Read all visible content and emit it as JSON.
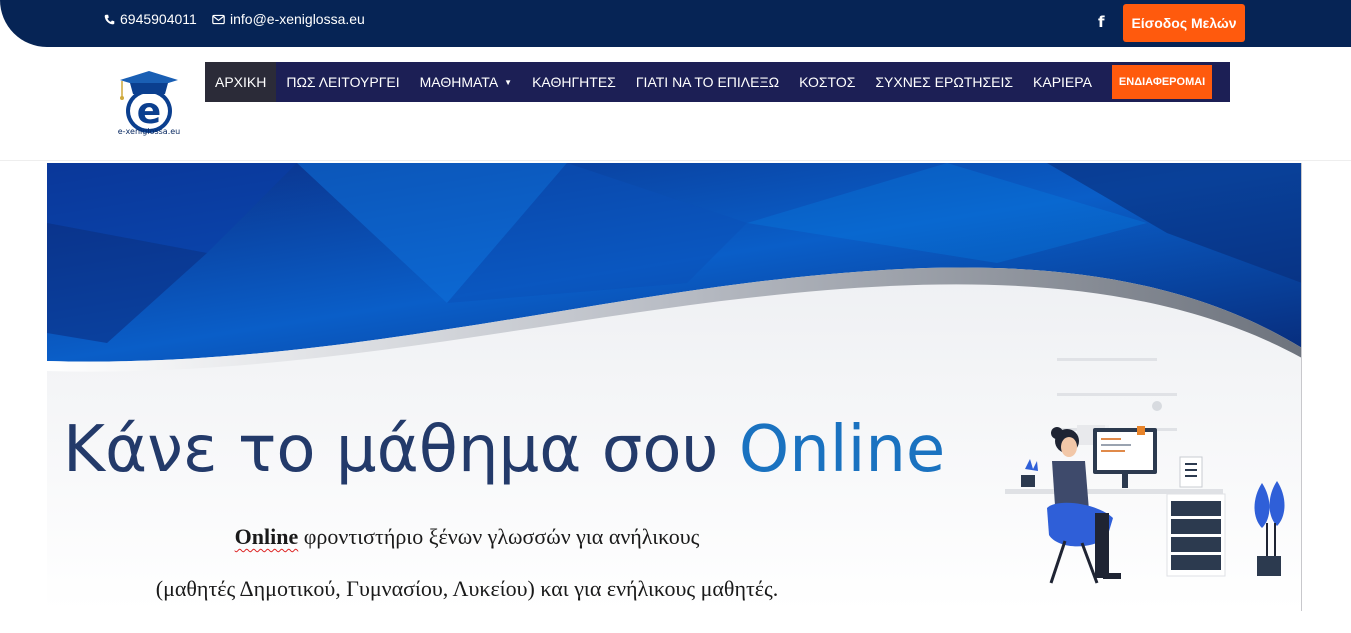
{
  "topbar": {
    "phone": "6945904011",
    "email": "info@e-xeniglossa.eu",
    "facebook_glyph": "f",
    "login_label": "Είσοδος Μελών"
  },
  "logo": {
    "letter": "e",
    "caption": "e-xeniglossa.eu"
  },
  "nav": {
    "items": [
      {
        "label": "ΑΡΧΙΚΗ"
      },
      {
        "label": "ΠΩΣ ΛΕΙΤΟΥΡΓΕΙ"
      },
      {
        "label": "ΜΑΘΗΜΑΤΑ"
      },
      {
        "label": "ΚΑΘΗΓΗΤΕΣ"
      },
      {
        "label": "ΓΙΑΤΙ ΝΑ ΤΟ ΕΠΙΛΕΞΩ"
      },
      {
        "label": "ΚΟΣΤΟΣ"
      },
      {
        "label": "ΣΥΧΝΕΣ ΕΡΩΤΗΣΕΙΣ"
      },
      {
        "label": "ΚΑΡΙΕΡΑ"
      }
    ],
    "cta_label": "ΕΝΔΙΑΦΕΡΟΜΑΙ",
    "active_index": 0
  },
  "banner": {
    "headline_part1": "Κάνε το μάθημα σου ",
    "headline_part2": "Online",
    "subline1_bold": "Online",
    "subline1_rest": "  φροντιστήριο ξένων γλωσσών για  ανήλικους",
    "subline2": "(μαθητές Δημοτικού, Γυμνασίου, Λυκείου) και για ενήλικους μαθητές."
  },
  "colors": {
    "topbar_bg": "#062455",
    "accent_orange": "#ff5a0d",
    "nav_bg": "#1c1f55",
    "headline_dark": "#233a6a",
    "headline_blue": "#1a72c0"
  },
  "icons": [
    "phone-icon",
    "envelope-icon",
    "facebook-icon",
    "caret-down-icon",
    "graduation-cap-icon"
  ]
}
